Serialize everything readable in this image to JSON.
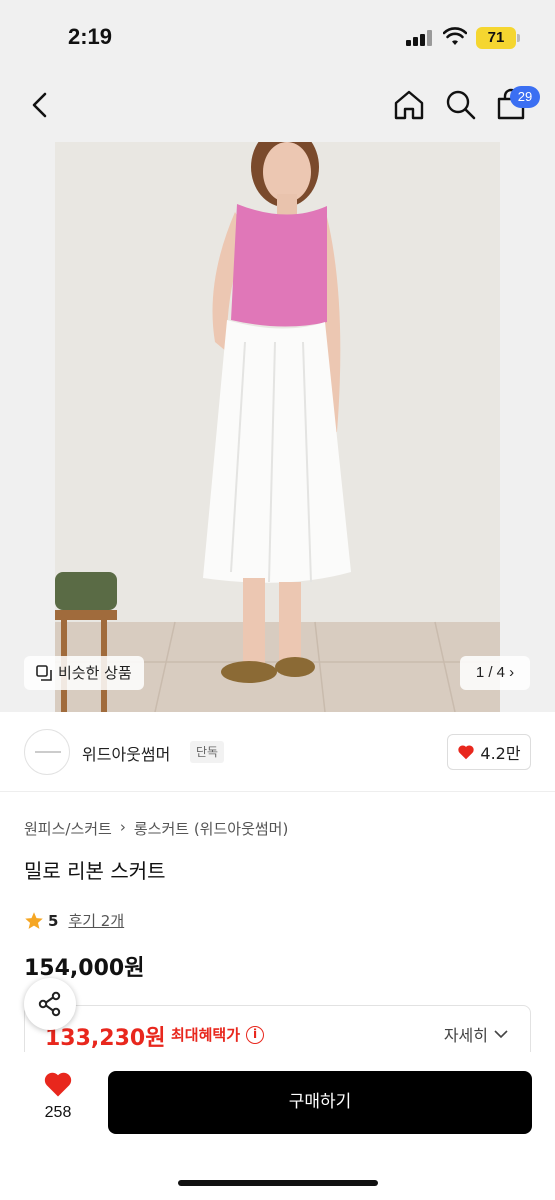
{
  "status_bar": {
    "time": "2:19",
    "battery": "71"
  },
  "nav": {
    "cart_count": "29"
  },
  "gallery": {
    "similar_label": "비슷한 상품",
    "page": "1 / 4"
  },
  "brand": {
    "name": "위드아웃썸머",
    "tag": "단독",
    "likes": "4.2만"
  },
  "product": {
    "category_main": "원피스/스커트",
    "category_sub": "롱스커트 (위드아웃썸머)",
    "title": "밀로 리본 스커트",
    "rating": "5",
    "reviews": "후기 2개",
    "price": "154,000원"
  },
  "benefit": {
    "price": "133,230원",
    "label": "최대혜택가",
    "detail_label": "자세히"
  },
  "bottom_bar": {
    "wish_count": "258",
    "buy_label": "구매하기"
  },
  "colors": {
    "accent_red": "#e8271d",
    "badge_blue": "#3b6ff2",
    "button_black": "#000000"
  }
}
